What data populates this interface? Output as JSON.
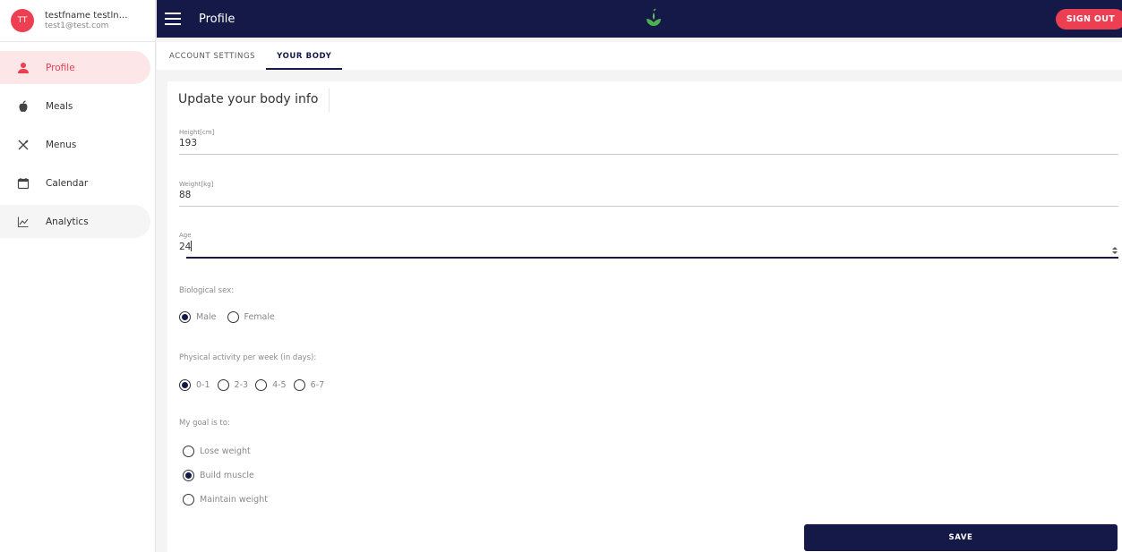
{
  "user": {
    "initials": "TT",
    "name": "testfname testlnam...",
    "email": "test1@test.com"
  },
  "sidebar": {
    "items": [
      {
        "label": "Profile",
        "icon": "person-icon",
        "active": true
      },
      {
        "label": "Meals",
        "icon": "apple-icon"
      },
      {
        "label": "Menus",
        "icon": "utensils-icon"
      },
      {
        "label": "Calendar",
        "icon": "calendar-icon"
      },
      {
        "label": "Analytics",
        "icon": "chart-line-icon"
      }
    ]
  },
  "topbar": {
    "title": "Profile",
    "sign_out": "SIGN OUT",
    "logo_icon": "leaf-logo-icon"
  },
  "tabs": [
    {
      "label": "ACCOUNT SETTINGS"
    },
    {
      "label": "YOUR BODY",
      "active": true
    }
  ],
  "form": {
    "title": "Update your body info",
    "height": {
      "label": "Height[cm]",
      "value": "193"
    },
    "weight": {
      "label": "Weight[kg]",
      "value": "88"
    },
    "age": {
      "label": "Age",
      "value": "24"
    },
    "sex": {
      "label": "Biological sex:",
      "options": [
        "Male",
        "Female"
      ],
      "selected": "Male"
    },
    "activity": {
      "label": "Physical activity per week (in days):",
      "options": [
        "0-1",
        "2-3",
        "4-5",
        "6-7"
      ],
      "selected": "0-1"
    },
    "goal": {
      "label": "My goal is to:",
      "options": [
        "Lose weight",
        "Build muscle",
        "Maintain weight"
      ],
      "selected": "Build muscle"
    },
    "save": "SAVE"
  },
  "colors": {
    "navy": "#141947",
    "accent": "#ec3f52",
    "active_bg": "#fde6e8"
  }
}
